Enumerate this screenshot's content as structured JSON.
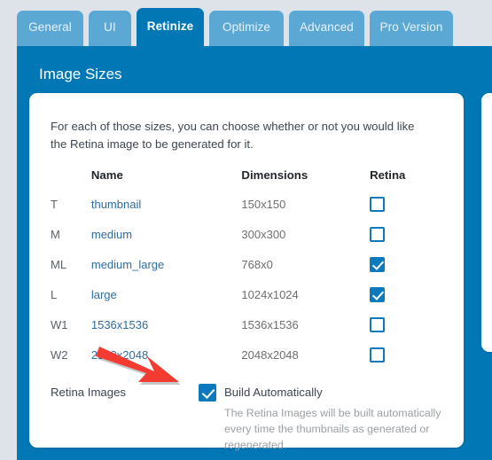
{
  "colors": {
    "accent": "#0277b6",
    "tab_inactive": "#5ba8d4",
    "page_bg": "#dde3e9",
    "link": "#2e6da4",
    "checkbox": "#0c79bd",
    "arrow": "#f43b32"
  },
  "tabs": [
    {
      "label": "General",
      "active": false
    },
    {
      "label": "UI",
      "active": false
    },
    {
      "label": "Retinize",
      "active": true
    },
    {
      "label": "Optimize",
      "active": false
    },
    {
      "label": "Advanced",
      "active": false
    },
    {
      "label": "Pro Version",
      "active": false
    }
  ],
  "panel": {
    "title": "Image Sizes"
  },
  "card": {
    "intro": "For each of those sizes, you can choose whether or not you would like the Retina image to be generated for it.",
    "table": {
      "headers": {
        "abbr": "",
        "name": "Name",
        "dimensions": "Dimensions",
        "retina": "Retina"
      },
      "rows": [
        {
          "abbr": "T",
          "name": "thumbnail",
          "dimensions": "150x150",
          "retina": false
        },
        {
          "abbr": "M",
          "name": "medium",
          "dimensions": "300x300",
          "retina": false
        },
        {
          "abbr": "ML",
          "name": "medium_large",
          "dimensions": "768x0",
          "retina": true
        },
        {
          "abbr": "L",
          "name": "large",
          "dimensions": "1024x1024",
          "retina": true
        },
        {
          "abbr": "W1",
          "name": "1536x1536",
          "dimensions": "1536x1536",
          "retina": false
        },
        {
          "abbr": "W2",
          "name": "2048x2048",
          "dimensions": "2048x2048",
          "retina": false
        }
      ]
    },
    "retina_images": {
      "label": "Retina Images",
      "build_checked": true,
      "build_label": "Build Automatically",
      "build_help": "The Retina Images will be built automatically every time the thumbnails as generated or regenerated."
    }
  },
  "annotation": {
    "arrow_name": "red-arrow-pointing-to-build-automatically-checkbox"
  }
}
